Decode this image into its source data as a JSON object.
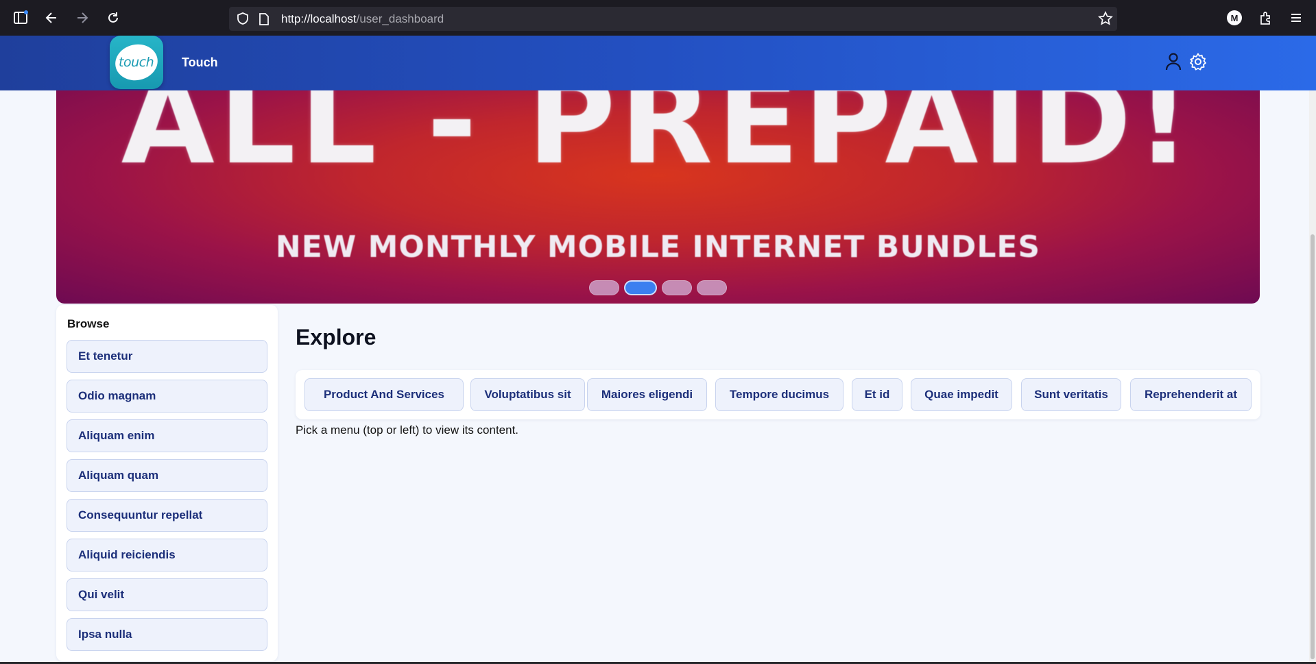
{
  "browser": {
    "url_host": "http://localhost",
    "url_path": "/user_dashboard",
    "profile_initial": "M"
  },
  "app": {
    "logo_text": "touch",
    "name": "Touch"
  },
  "banner": {
    "headline": "ALL - PREPAID!",
    "subline": "NEW MONTHLY MOBILE INTERNET BUNDLES",
    "slide_count": 4,
    "active_slide": 2
  },
  "sidebar": {
    "title": "Browse",
    "items": [
      {
        "label": "Et tenetur"
      },
      {
        "label": "Odio magnam"
      },
      {
        "label": "Aliquam enim"
      },
      {
        "label": "Aliquam quam"
      },
      {
        "label": "Consequuntur repellat"
      },
      {
        "label": "Aliquid reiciendis"
      },
      {
        "label": "Qui velit"
      },
      {
        "label": "Ipsa nulla"
      }
    ]
  },
  "main": {
    "title": "Explore",
    "tabs": [
      {
        "label": "Product And Services"
      },
      {
        "label": "Voluptatibus sit"
      },
      {
        "label": "Maiores eligendi"
      },
      {
        "label": "Tempore ducimus"
      },
      {
        "label": "Et id"
      },
      {
        "label": "Quae impedit"
      },
      {
        "label": "Sunt veritatis"
      },
      {
        "label": "Reprehenderit at"
      }
    ],
    "hint": "Pick a menu (top or left) to view its content."
  },
  "colors": {
    "header_start": "#1f3f9c",
    "header_end": "#2b6ae8",
    "pill_bg": "#eef2fc",
    "pill_text": "#1c2f7a",
    "active_dot": "#3b7ff0"
  }
}
